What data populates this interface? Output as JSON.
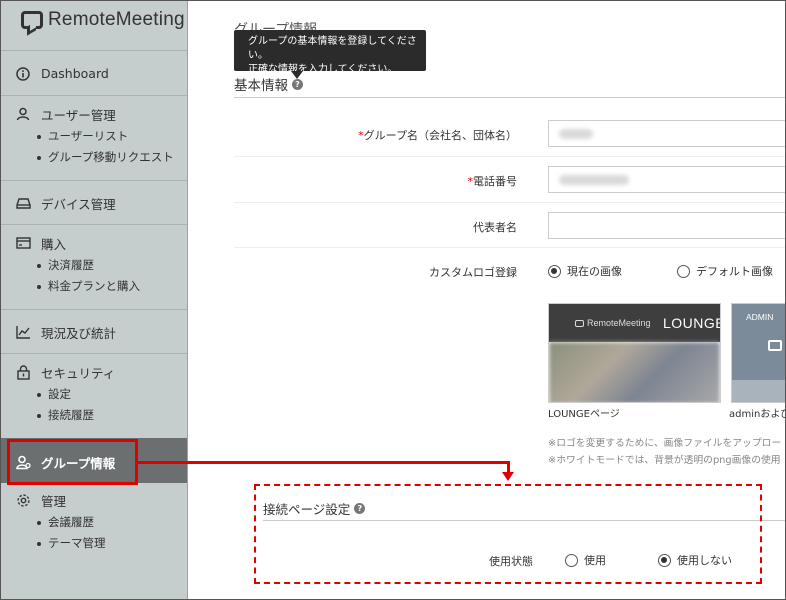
{
  "app": {
    "logo_text": "RemoteMeeting"
  },
  "sidebar": {
    "dashboard": "Dashboard",
    "user_mgmt": "ユーザー管理",
    "user_list": "ユーザーリスト",
    "group_move": "グループ移動リクエスト",
    "device_mgmt": "デバイス管理",
    "purchase": "購入",
    "payment_history": "決済履歴",
    "plan_purchase": "料金プランと購入",
    "stats": "現況及び統計",
    "security": "セキュリティ",
    "settings": "設定",
    "access_history": "接続履歴",
    "group_info": "グループ情報",
    "admin": "管理",
    "meeting_history": "会議履歴",
    "theme_mgmt": "テーマ管理"
  },
  "main": {
    "page_title": "グループ情報",
    "tooltip_line1": "グループの基本情報を登録してください。",
    "tooltip_line2": "正確な情報を入力してください。",
    "basic_info_title": "基本情報",
    "help_glyph": "?",
    "required_mark": "*",
    "group_name_label": "グループ名（会社名、団体名）",
    "phone_label": "電話番号",
    "rep_name_label": "代表者名",
    "custom_logo_label": "カスタムロゴ登録",
    "radio_current": "現在の画像",
    "radio_default": "デフォルト画像",
    "thumb1_logo": "RemoteMeeting",
    "thumb1_title": "LOUNGE",
    "thumb2_title": "ADMIN",
    "thumb1_caption": "LOUNGEページ",
    "thumb2_caption": "adminおよび",
    "note1": "※ロゴを変更するために、画像ファイルをアップロー",
    "note2": "※ホワイトモードでは、背景が透明のpng画像の使用",
    "connection_title": "接続ページ設定",
    "usage_label": "使用状態",
    "radio_use": "使用",
    "radio_not_use": "使用しない"
  },
  "colors": {
    "sidebar_bg": "#c5cdcd",
    "active_bg": "#6b6f70",
    "highlight_red": "#e00000"
  }
}
